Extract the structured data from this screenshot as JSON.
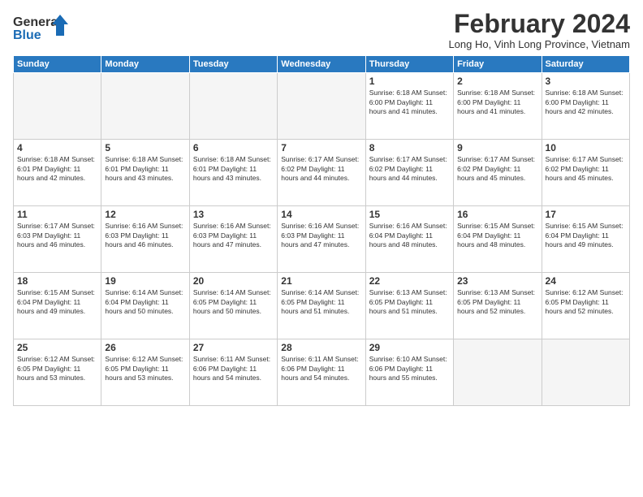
{
  "header": {
    "logo_line1": "General",
    "logo_line2": "Blue",
    "month_title": "February 2024",
    "location": "Long Ho, Vinh Long Province, Vietnam"
  },
  "weekdays": [
    "Sunday",
    "Monday",
    "Tuesday",
    "Wednesday",
    "Thursday",
    "Friday",
    "Saturday"
  ],
  "weeks": [
    [
      {
        "day": "",
        "info": ""
      },
      {
        "day": "",
        "info": ""
      },
      {
        "day": "",
        "info": ""
      },
      {
        "day": "",
        "info": ""
      },
      {
        "day": "1",
        "info": "Sunrise: 6:18 AM\nSunset: 6:00 PM\nDaylight: 11 hours\nand 41 minutes."
      },
      {
        "day": "2",
        "info": "Sunrise: 6:18 AM\nSunset: 6:00 PM\nDaylight: 11 hours\nand 41 minutes."
      },
      {
        "day": "3",
        "info": "Sunrise: 6:18 AM\nSunset: 6:00 PM\nDaylight: 11 hours\nand 42 minutes."
      }
    ],
    [
      {
        "day": "4",
        "info": "Sunrise: 6:18 AM\nSunset: 6:01 PM\nDaylight: 11 hours\nand 42 minutes."
      },
      {
        "day": "5",
        "info": "Sunrise: 6:18 AM\nSunset: 6:01 PM\nDaylight: 11 hours\nand 43 minutes."
      },
      {
        "day": "6",
        "info": "Sunrise: 6:18 AM\nSunset: 6:01 PM\nDaylight: 11 hours\nand 43 minutes."
      },
      {
        "day": "7",
        "info": "Sunrise: 6:17 AM\nSunset: 6:02 PM\nDaylight: 11 hours\nand 44 minutes."
      },
      {
        "day": "8",
        "info": "Sunrise: 6:17 AM\nSunset: 6:02 PM\nDaylight: 11 hours\nand 44 minutes."
      },
      {
        "day": "9",
        "info": "Sunrise: 6:17 AM\nSunset: 6:02 PM\nDaylight: 11 hours\nand 45 minutes."
      },
      {
        "day": "10",
        "info": "Sunrise: 6:17 AM\nSunset: 6:02 PM\nDaylight: 11 hours\nand 45 minutes."
      }
    ],
    [
      {
        "day": "11",
        "info": "Sunrise: 6:17 AM\nSunset: 6:03 PM\nDaylight: 11 hours\nand 46 minutes."
      },
      {
        "day": "12",
        "info": "Sunrise: 6:16 AM\nSunset: 6:03 PM\nDaylight: 11 hours\nand 46 minutes."
      },
      {
        "day": "13",
        "info": "Sunrise: 6:16 AM\nSunset: 6:03 PM\nDaylight: 11 hours\nand 47 minutes."
      },
      {
        "day": "14",
        "info": "Sunrise: 6:16 AM\nSunset: 6:03 PM\nDaylight: 11 hours\nand 47 minutes."
      },
      {
        "day": "15",
        "info": "Sunrise: 6:16 AM\nSunset: 6:04 PM\nDaylight: 11 hours\nand 48 minutes."
      },
      {
        "day": "16",
        "info": "Sunrise: 6:15 AM\nSunset: 6:04 PM\nDaylight: 11 hours\nand 48 minutes."
      },
      {
        "day": "17",
        "info": "Sunrise: 6:15 AM\nSunset: 6:04 PM\nDaylight: 11 hours\nand 49 minutes."
      }
    ],
    [
      {
        "day": "18",
        "info": "Sunrise: 6:15 AM\nSunset: 6:04 PM\nDaylight: 11 hours\nand 49 minutes."
      },
      {
        "day": "19",
        "info": "Sunrise: 6:14 AM\nSunset: 6:04 PM\nDaylight: 11 hours\nand 50 minutes."
      },
      {
        "day": "20",
        "info": "Sunrise: 6:14 AM\nSunset: 6:05 PM\nDaylight: 11 hours\nand 50 minutes."
      },
      {
        "day": "21",
        "info": "Sunrise: 6:14 AM\nSunset: 6:05 PM\nDaylight: 11 hours\nand 51 minutes."
      },
      {
        "day": "22",
        "info": "Sunrise: 6:13 AM\nSunset: 6:05 PM\nDaylight: 11 hours\nand 51 minutes."
      },
      {
        "day": "23",
        "info": "Sunrise: 6:13 AM\nSunset: 6:05 PM\nDaylight: 11 hours\nand 52 minutes."
      },
      {
        "day": "24",
        "info": "Sunrise: 6:12 AM\nSunset: 6:05 PM\nDaylight: 11 hours\nand 52 minutes."
      }
    ],
    [
      {
        "day": "25",
        "info": "Sunrise: 6:12 AM\nSunset: 6:05 PM\nDaylight: 11 hours\nand 53 minutes."
      },
      {
        "day": "26",
        "info": "Sunrise: 6:12 AM\nSunset: 6:05 PM\nDaylight: 11 hours\nand 53 minutes."
      },
      {
        "day": "27",
        "info": "Sunrise: 6:11 AM\nSunset: 6:06 PM\nDaylight: 11 hours\nand 54 minutes."
      },
      {
        "day": "28",
        "info": "Sunrise: 6:11 AM\nSunset: 6:06 PM\nDaylight: 11 hours\nand 54 minutes."
      },
      {
        "day": "29",
        "info": "Sunrise: 6:10 AM\nSunset: 6:06 PM\nDaylight: 11 hours\nand 55 minutes."
      },
      {
        "day": "",
        "info": ""
      },
      {
        "day": "",
        "info": ""
      }
    ]
  ]
}
